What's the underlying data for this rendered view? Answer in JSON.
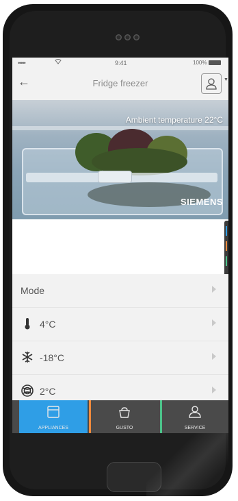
{
  "status_bar": {
    "signal": "•••••",
    "time": "9:41",
    "battery": "100%"
  },
  "nav": {
    "back_icon": "back-arrow-icon",
    "title": "Fridge freezer",
    "profile_icon": "user-icon"
  },
  "hero": {
    "ambient_temperature": "Ambient temperature 22°C",
    "brand": "SIEMENS"
  },
  "settings": {
    "mode_label": "Mode",
    "rows": [
      {
        "icon": "thermometer-icon",
        "value": "4°C"
      },
      {
        "icon": "snowflake-icon",
        "value": "-18°C"
      },
      {
        "icon": "vitafresh-icon",
        "value": "2°C"
      }
    ]
  },
  "tabs": [
    {
      "label": "APPLIANCES",
      "icon": "appliance-icon",
      "selected": true
    },
    {
      "label": "GUSTO",
      "icon": "cooking-pot-icon",
      "selected": false
    },
    {
      "label": "SERVICE",
      "icon": "service-user-icon",
      "selected": false
    }
  ],
  "colors": {
    "appliances_accent": "#2f9ee6",
    "gusto_accent": "#f08a3c",
    "service_accent": "#4cc38a"
  }
}
